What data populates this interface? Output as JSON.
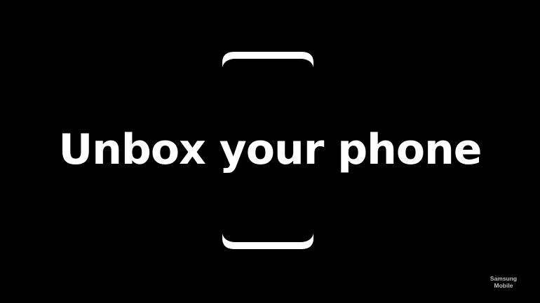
{
  "headline": "Unbox your phone",
  "watermark": {
    "line1": "Samsung",
    "line2": "Mobile"
  },
  "icons": {
    "phone_outline": "phone-outline-icon"
  },
  "colors": {
    "background": "#000000",
    "text": "#ffffff",
    "watermark": "#bdbdbd"
  }
}
